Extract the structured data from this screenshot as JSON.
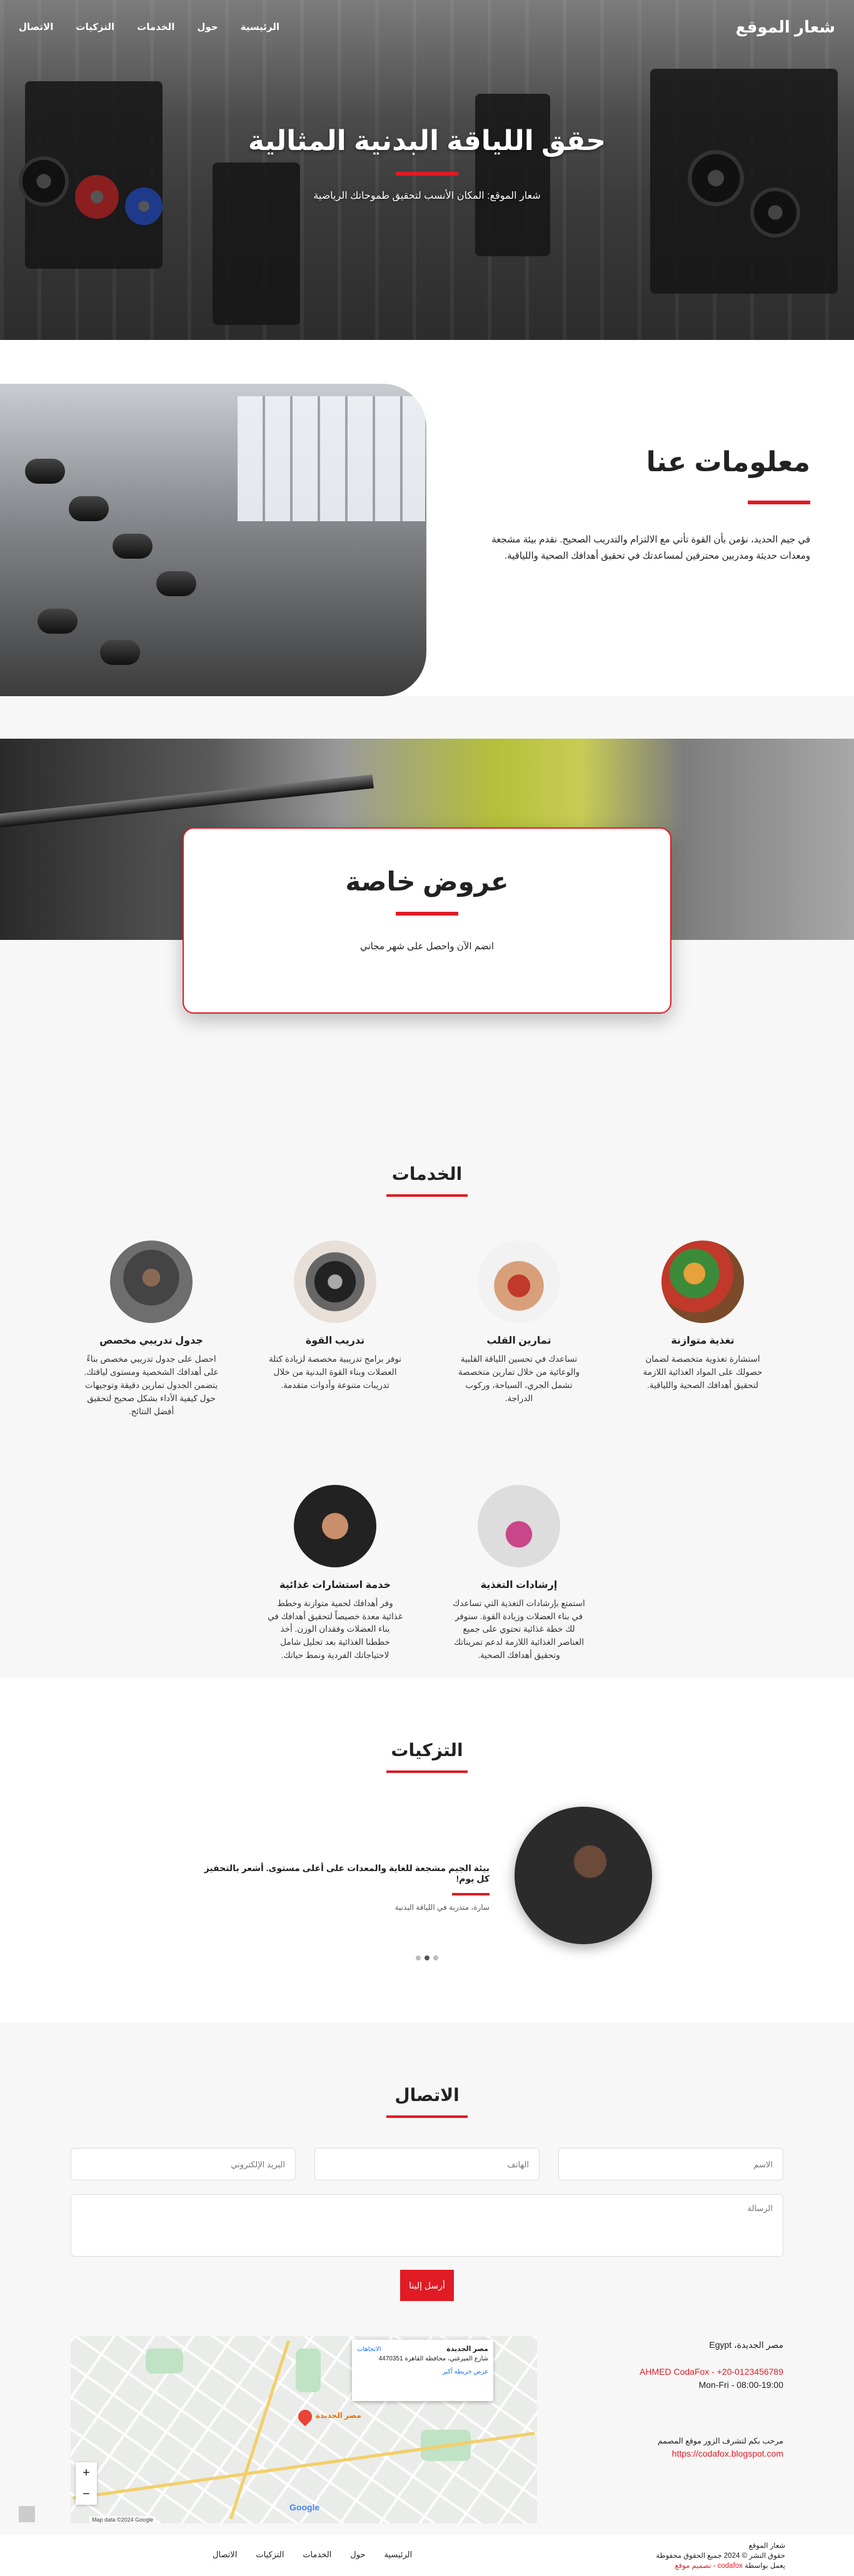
{
  "brand": "شعار الموقع",
  "nav": {
    "home": "الرئيسية",
    "about": "حول",
    "services": "الخدمات",
    "testimonials": "التزكيات",
    "contact": "الاتصال"
  },
  "hero": {
    "title": "حقق اللياقة البدنية المثالية",
    "subtitle": "شعار الموقع: المكان الأنسب لتحقيق طموحاتك الرياضية"
  },
  "about": {
    "title": "معلومات عنا",
    "text": "في جيم الحديد، نؤمن بأن القوة تأتي مع الالتزام والتدريب الصحيح. نقدم بيئة مشجعة ومعدات حديثة ومدربين محترفين لمساعدتك في تحقيق أهدافك الصحية واللياقية."
  },
  "offer": {
    "title": "عروض خاصة",
    "text": "انضم الآن واحصل على شهر مجاني"
  },
  "services": {
    "title": "الخدمات",
    "items": [
      {
        "title": "تغذية متوازنة",
        "desc": "استشارة تغذوية متخصصة لضمان حصولك على المواد الغذائية اللازمة لتحقيق أهدافك الصحية واللياقية."
      },
      {
        "title": "تمارين القلب",
        "desc": "تساعدك في تحسين اللياقة القلبية والوعائية من خلال تمارين متخصصة تشمل الجري، السباحة، وركوب الدراجة."
      },
      {
        "title": "تدريب القوة",
        "desc": "نوفر برامج تدريبية مخصصة لزيادة كتلة العضلات وبناء القوة البدنية من خلال تدريبات متنوعة وأدوات متقدمة."
      },
      {
        "title": "جدول تدريبي مخصص",
        "desc": "احصل على جدول تدريبي مخصص بناءً على أهدافك الشخصية ومستوى لياقتك. يتضمن الجدول تمارين دقيقة وتوجيهات حول كيفية الأداء بشكل صحيح لتحقيق أفضل النتائج."
      },
      {
        "title": "إرشادات التغذية",
        "desc": "استمتع بإرشادات التغذية التي تساعدك في بناء العضلات وزيادة القوة. سنوفر لك خطة غذائية تحتوي على جميع العناصر الغذائية اللازمة لدعم تمريناتك وتحقيق أهدافك الصحية."
      },
      {
        "title": "خدمة استشارات غذائية",
        "desc": "وفر أهدافك لحمية متوازنة وخطط غذائية معدة خصيصاً لتحقيق أهدافك في بناء العضلات وفقدان الوزن. أخذ خططنا الغذائية بعد تحليل شامل لاحتياجاتك الفردية ونمط حياتك."
      }
    ]
  },
  "testimonials": {
    "title": "التزكيات",
    "quote": "بيئة الجيم مشجعة للغاية والمعدات على أعلى مستوى. أشعر بالتحفيز كل يوم!",
    "author": "سارة، متدربة في اللياقة البدنية"
  },
  "contact": {
    "title": "الاتصال",
    "name_ph": "الاسم",
    "phone_ph": "الهاتف",
    "email_ph": "البريد الإلكتروني",
    "msg_ph": "الرسالة",
    "send": "أرسل إلينا",
    "address": "مصر الجديدة، Egypt",
    "phone": "AHMED CodaFox - +20-0123456789",
    "hours": "Mon-Fri - 08:00-19:00",
    "credit_line": "مرحب بكم لتشرف الزور موقع المصمم",
    "credit_url": "https://codafox.blogspot.com",
    "map": {
      "card_title": "مصر الجديدة",
      "card_addr": "شارع الميرغني، محافظة القاهرة 4470351",
      "card_dir": "الاتجاهات",
      "card_link": "عرض خريطة أكبر",
      "label": "مصر الجديدة",
      "google": "Google",
      "data": "Map data ©2024 Google"
    }
  },
  "footer": {
    "site": "شعار الموقع",
    "copyright": "حقوق النشر © 2024 جميع الحقوق محفوظة",
    "powered_prefix": "يعمل بواسطة ",
    "powered_brand": "codafox",
    "powered_suffix": " - تصميم موقع"
  },
  "colors": {
    "accent": "#e01b24"
  }
}
